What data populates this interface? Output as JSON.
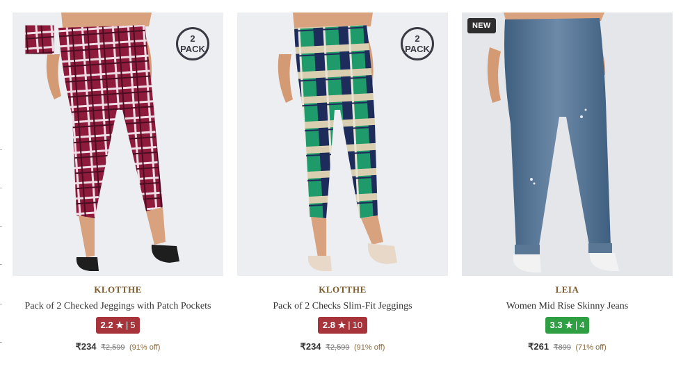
{
  "colors": {
    "rating_low": "#a7343a",
    "rating_high": "#2ea043",
    "brand_text": "#7d5a2c"
  },
  "products": [
    {
      "brand": "KLOTTHE",
      "title": "Pack of 2 Checked Jeggings with Patch Pockets",
      "pack_badge": [
        "2",
        "PACK"
      ],
      "rating": "2.2",
      "rating_count": "5",
      "rating_color": "#a7343a",
      "price": "₹234",
      "mrp": "₹2,599",
      "discount": "(91% off)",
      "image": "maroon-checked-jeggings-image"
    },
    {
      "brand": "KLOTTHE",
      "title": "Pack of 2 Checks Slim-Fit Jeggings",
      "pack_badge": [
        "2",
        "PACK"
      ],
      "rating": "2.8",
      "rating_count": "10",
      "rating_color": "#a7343a",
      "price": "₹234",
      "mrp": "₹2,599",
      "discount": "(91% off)",
      "image": "green-checked-jeggings-image"
    },
    {
      "brand": "LEIA",
      "title": "Women Mid Rise Skinny Jeans",
      "new_badge": "NEW",
      "rating": "3.3",
      "rating_count": "4",
      "rating_color": "#2ea043",
      "price": "₹261",
      "mrp": "₹899",
      "discount": "(71% off)",
      "image": "blue-skinny-jeans-image"
    }
  ]
}
